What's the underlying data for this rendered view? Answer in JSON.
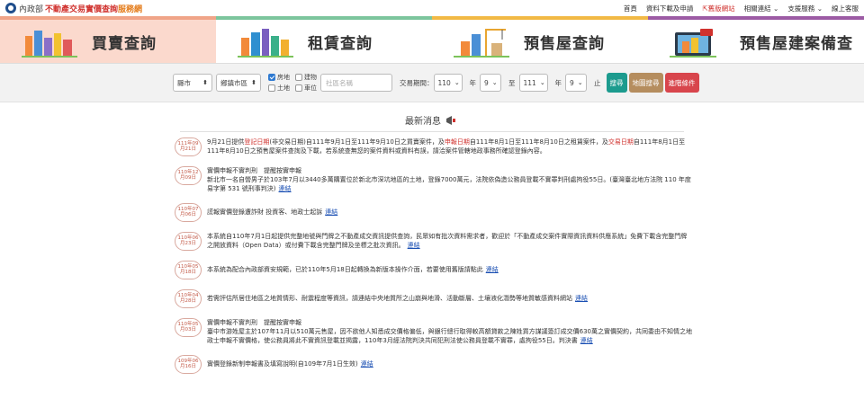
{
  "header": {
    "ministry": "內政部",
    "site_title_red": "不動產交易實價查詢",
    "site_title_orange": "服務網",
    "links": [
      "首頁",
      "資料下載及申請",
      "舊版網站",
      "相關連結",
      "支援服務",
      "線上客服"
    ]
  },
  "tabs": [
    {
      "label": "買賣查詢"
    },
    {
      "label": "租賃查詢"
    },
    {
      "label": "預售屋查詢"
    },
    {
      "label": "預售屋建案備查"
    }
  ],
  "filter": {
    "city": "縣市",
    "district": "鄉鎮市區",
    "checkboxes": [
      {
        "label": "房地",
        "checked": true
      },
      {
        "label": "建物",
        "checked": false
      },
      {
        "label": "土地",
        "checked": false
      },
      {
        "label": "車位",
        "checked": false
      }
    ],
    "community_placeholder": "社區名稱",
    "period_label": "交易期間：",
    "from_year": "110",
    "year_unit": "年",
    "from_month": "9",
    "to_label": "至",
    "to_year": "111",
    "to_month": "9",
    "end_label": "止",
    "search_button": "搜尋",
    "map_button": "地圖搜尋",
    "advanced_button": "進階條件"
  },
  "news": {
    "title": "最新消息",
    "items": [
      {
        "date1": "111年09",
        "date2": "月21日",
        "parts": [
          "9月21日提供",
          "登記日期",
          "(非交易日期)自111年9月1日至111年9月10日之買賣案件，及",
          "申報日期",
          "自111年8月1日至111年8月10日之租賃案件，及",
          "交易日期",
          "自111年8月1日至111年8月10日之預售屋案件查詢及下載，若系統查無您的案件資料或資料有誤，請洽案件管轄地政事務所確認登錄內容。"
        ]
      },
      {
        "date1": "110年12",
        "date2": "月09日",
        "line1": "實價申報不實判刑　提醒按實申報",
        "line2": "新北市一名自營男子於103年7月以3440多萬購置位於新北市深坑地區的土地，登錄7000萬元，法院依偽造公務員登載不實罪判刑處拘役55日。(臺灣臺北地方法院 110 年度易字第 531 號刑事判決)",
        "link": "連結"
      },
      {
        "date1": "110年07",
        "date2": "月06日",
        "line1": "謊報實價登錄遭詐財 投資客、地政士起訴",
        "link": "連結"
      },
      {
        "date1": "110年06",
        "date2": "月23日",
        "line1": "本系統自110年7月1日起提供完整地號與門牌之不動產成交資訊提供查詢，民眾如有批次資料需求者，歡迎於「不動產成交案件實際資訊資料供應系統」免費下載含完整門牌之開放資料（Open Data）或付費下載含完整門牌及坐標之批次資訊。",
        "link": "連結"
      },
      {
        "date1": "110年05",
        "date2": "月18日",
        "line1": "本系統為配合內政部資安規範，已於110年5月18日起轉換為新版本操作介面，若要使用舊版請點此",
        "link": "連結"
      },
      {
        "date1": "110年04",
        "date2": "月28日",
        "line1": "若需評估所居住地區之地質情形、耐震程度等資訊，請連結中央地質所之山崩與地滑、活動斷層、土壤液化潛勢等地質敏感資料網站",
        "link": "連結"
      },
      {
        "date1": "110年05",
        "date2": "月03日",
        "line1": "實價申報不實判刑　提醒按實申報",
        "line2": "臺中市游姓屋主於107年11月以510萬元售屋，因不欲他人知悉成交價格偏低，與銀行總行取得較高額貸款之陳姓買方謀議簽訂成交價630萬之實價契約，共同委由不知情之地政士申報不實價格，使公務員將此不實資訊登載並揭露，110年3月經法院判決共同犯刑法使公務員登載不實罪，處拘役55日。判決書",
        "link": "連結"
      },
      {
        "date1": "109年06",
        "date2": "月16日",
        "line1": "實價登錄新制申報書及填寫說明(自109年7月1日生效)",
        "link": "連結"
      }
    ]
  },
  "colors": {
    "accent_red": "#d0322e",
    "tab_active": "#fbd9cd",
    "search_btn": "#1c9b8e",
    "map_btn": "#b58d5e",
    "adv_btn": "#d8454c"
  }
}
